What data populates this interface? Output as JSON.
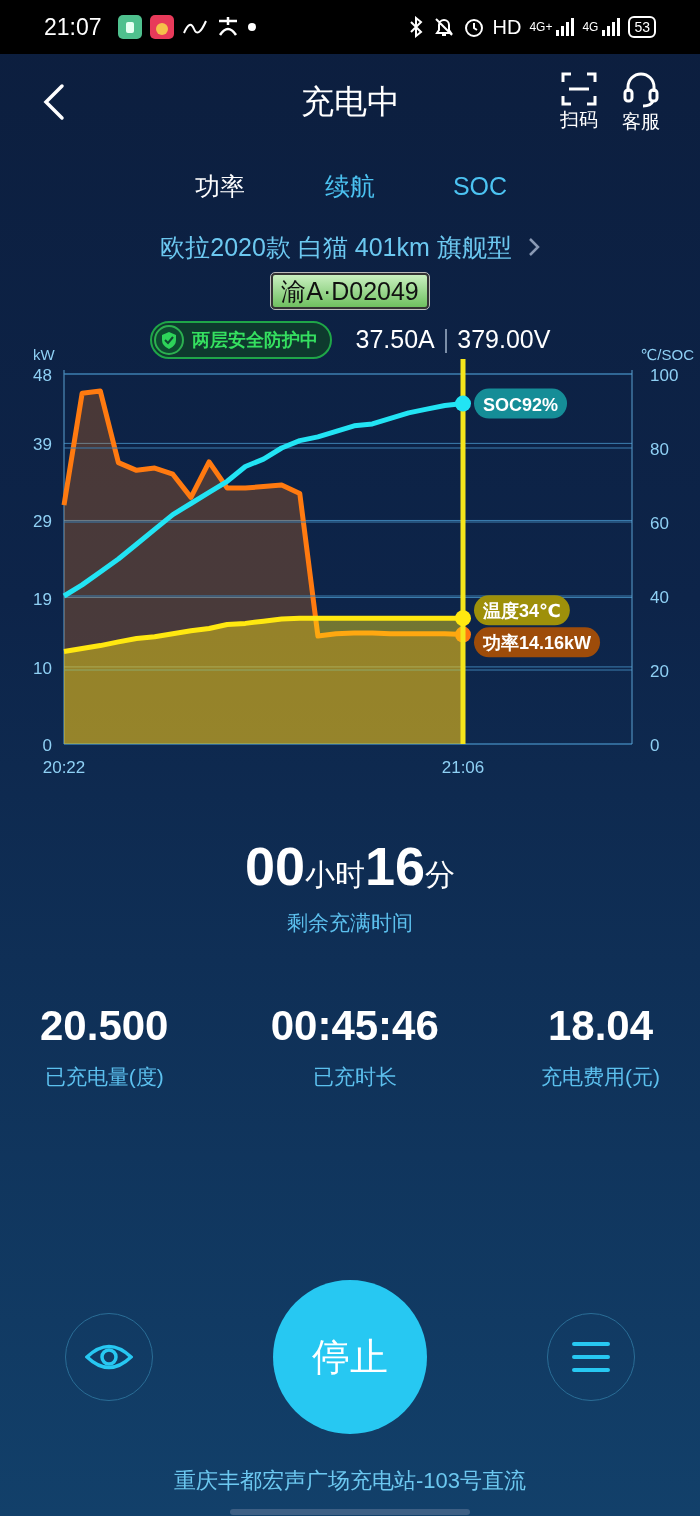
{
  "status_bar": {
    "time": "21:07",
    "hd": "HD",
    "networks": [
      "4G+",
      "4G"
    ],
    "battery": "53"
  },
  "header": {
    "title": "充电中",
    "actions": [
      {
        "kind": "scan",
        "label": "扫码"
      },
      {
        "kind": "service",
        "label": "客服"
      }
    ]
  },
  "tabs": [
    {
      "label": "功率",
      "selected": true
    },
    {
      "label": "续航",
      "selected": false
    },
    {
      "label": "SOC",
      "selected": false
    }
  ],
  "vehicle": {
    "model": "欧拉2020款 白猫 401km 旗舰型",
    "plate": "渝A·D02049"
  },
  "protection": {
    "label": "两层安全防护中"
  },
  "reading": {
    "current": "37.50A",
    "separator": "|",
    "voltage": "379.00V"
  },
  "charts": [
    {
      "chart_data": {
        "type": "area",
        "ylabel": "kW",
        "grid": true,
        "categories": [
          null,
          null,
          null,
          null,
          null,
          null,
          null,
          null,
          null,
          null,
          null,
          null,
          null,
          null,
          null,
          null,
          null,
          null,
          null,
          null,
          null,
          null,
          null
        ],
        "ylim": [
          0,
          48
        ],
        "yticks": [
          0,
          10,
          19,
          29,
          39,
          48
        ],
        "series": [
          {
            "color": "#ff7a10",
            "values": [
              31,
              45.5,
              45.8,
              36.5,
              35.5,
              35.8,
              35,
              32,
              36.6,
              33.2,
              33.2,
              33.4,
              33.6,
              32.5,
              14,
              14.3,
              14.4,
              14.4,
              14.3,
              14.3,
              14.3,
              14.3,
              14.2
            ]
          }
        ],
        "annotations": [
          "功率14.16kW"
        ]
      }
    },
    {
      "chart_data": {
        "type": "line",
        "ylabel": "℃/SOC",
        "grid": true,
        "categories": [
          "20:22",
          null,
          null,
          null,
          null,
          null,
          null,
          null,
          null,
          null,
          null,
          null,
          null,
          null,
          null,
          null,
          null,
          null,
          null,
          null,
          null,
          null,
          "21:06"
        ],
        "ylim": [
          0,
          100
        ],
        "yticks": [
          0,
          20,
          40,
          60,
          80,
          100
        ],
        "series": [
          {
            "color": "#ffe810",
            "type": "area",
            "values": [
              25,
              25.8,
              26.6,
              27.6,
              28.5,
              29,
              29.8,
              30.6,
              31.2,
              32.3,
              32.6,
              33.2,
              33.8,
              34,
              34,
              34,
              34,
              34,
              34,
              34,
              34,
              34,
              34
            ]
          },
          {
            "color": "#22e4f4",
            "type": "line",
            "values": [
              40,
              43,
              46.5,
              50,
              54,
              58,
              62,
              65,
              68,
              71,
              75,
              77,
              80,
              82,
              83,
              84.5,
              86,
              86.5,
              88,
              89.5,
              90.5,
              91.5,
              92
            ]
          }
        ],
        "annotations": [
          {
            "x": "21:06",
            "y": 92,
            "text": "SOC92%"
          },
          {
            "x": "21:06",
            "y": 34,
            "text": "温度34℃"
          }
        ]
      }
    }
  ],
  "remaining": {
    "hours": "00",
    "hours_unit": "小时",
    "minutes": "16",
    "minutes_unit": "分",
    "label": "剩余充满时间"
  },
  "stats": [
    {
      "value": "20.500",
      "label": "已充电量(度)"
    },
    {
      "value": "00:45:46",
      "label": "已充时长"
    },
    {
      "value": "18.04",
      "label": "充电费用(元)"
    }
  ],
  "controls": [
    {
      "kind": "eye"
    },
    {
      "kind": "stop",
      "label": "停止"
    },
    {
      "kind": "menu"
    }
  ],
  "station": "重庆丰都宏声广场充电站-103号直流"
}
